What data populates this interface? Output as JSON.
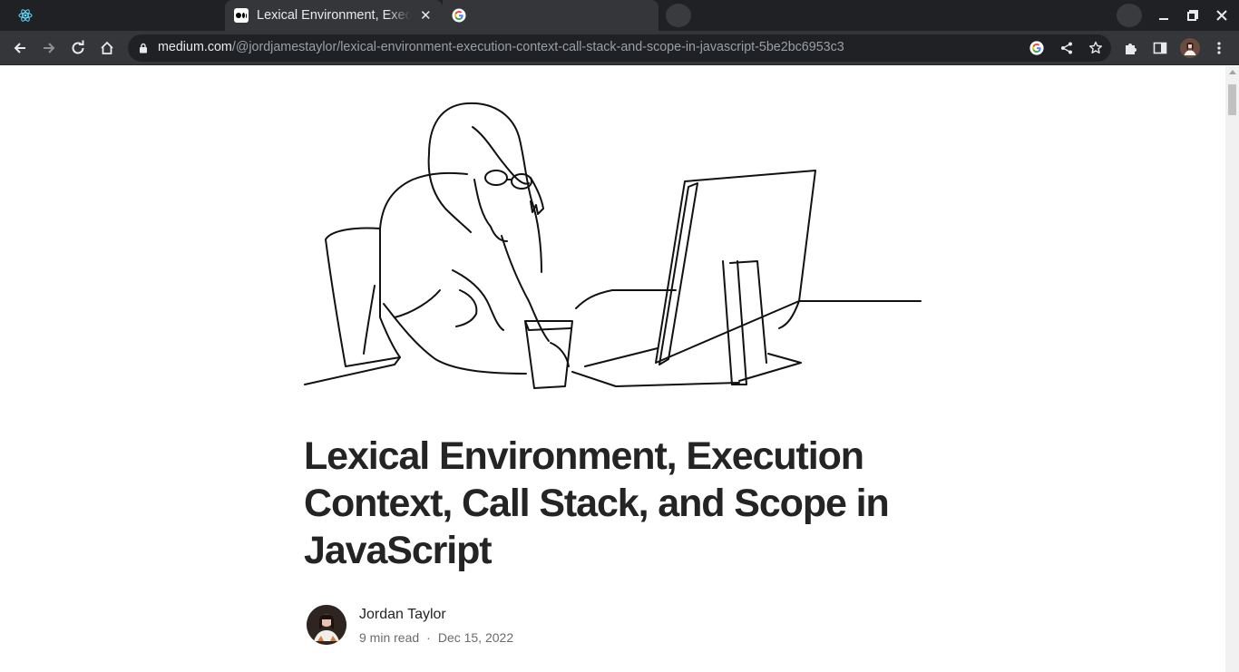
{
  "browser": {
    "tabs": [
      {
        "title": "",
        "icon": "react-icon"
      },
      {
        "title": "Lexical Environment, Execution Context, Call Stack, and Scope in JavaScript",
        "icon": "medium-icon",
        "active": true
      },
      {
        "title": "",
        "icon": "google-icon"
      }
    ],
    "close_glyph": "✕",
    "url": {
      "host": "medium.com",
      "path": "/@jordjamestaylor/lexical-environment-execution-context-call-stack-and-scope-in-javascript-5be2bc6953c3"
    },
    "colors": {
      "tabstrip": "#202124",
      "toolbar": "#35363a",
      "omnibox": "#202124"
    }
  },
  "article": {
    "title": "Lexical Environment, Execution Context, Call Stack, and Scope in JavaScript",
    "author": "Jordan Taylor",
    "read_time": "9 min read",
    "separator": "·",
    "date": "Dec 15, 2022"
  }
}
